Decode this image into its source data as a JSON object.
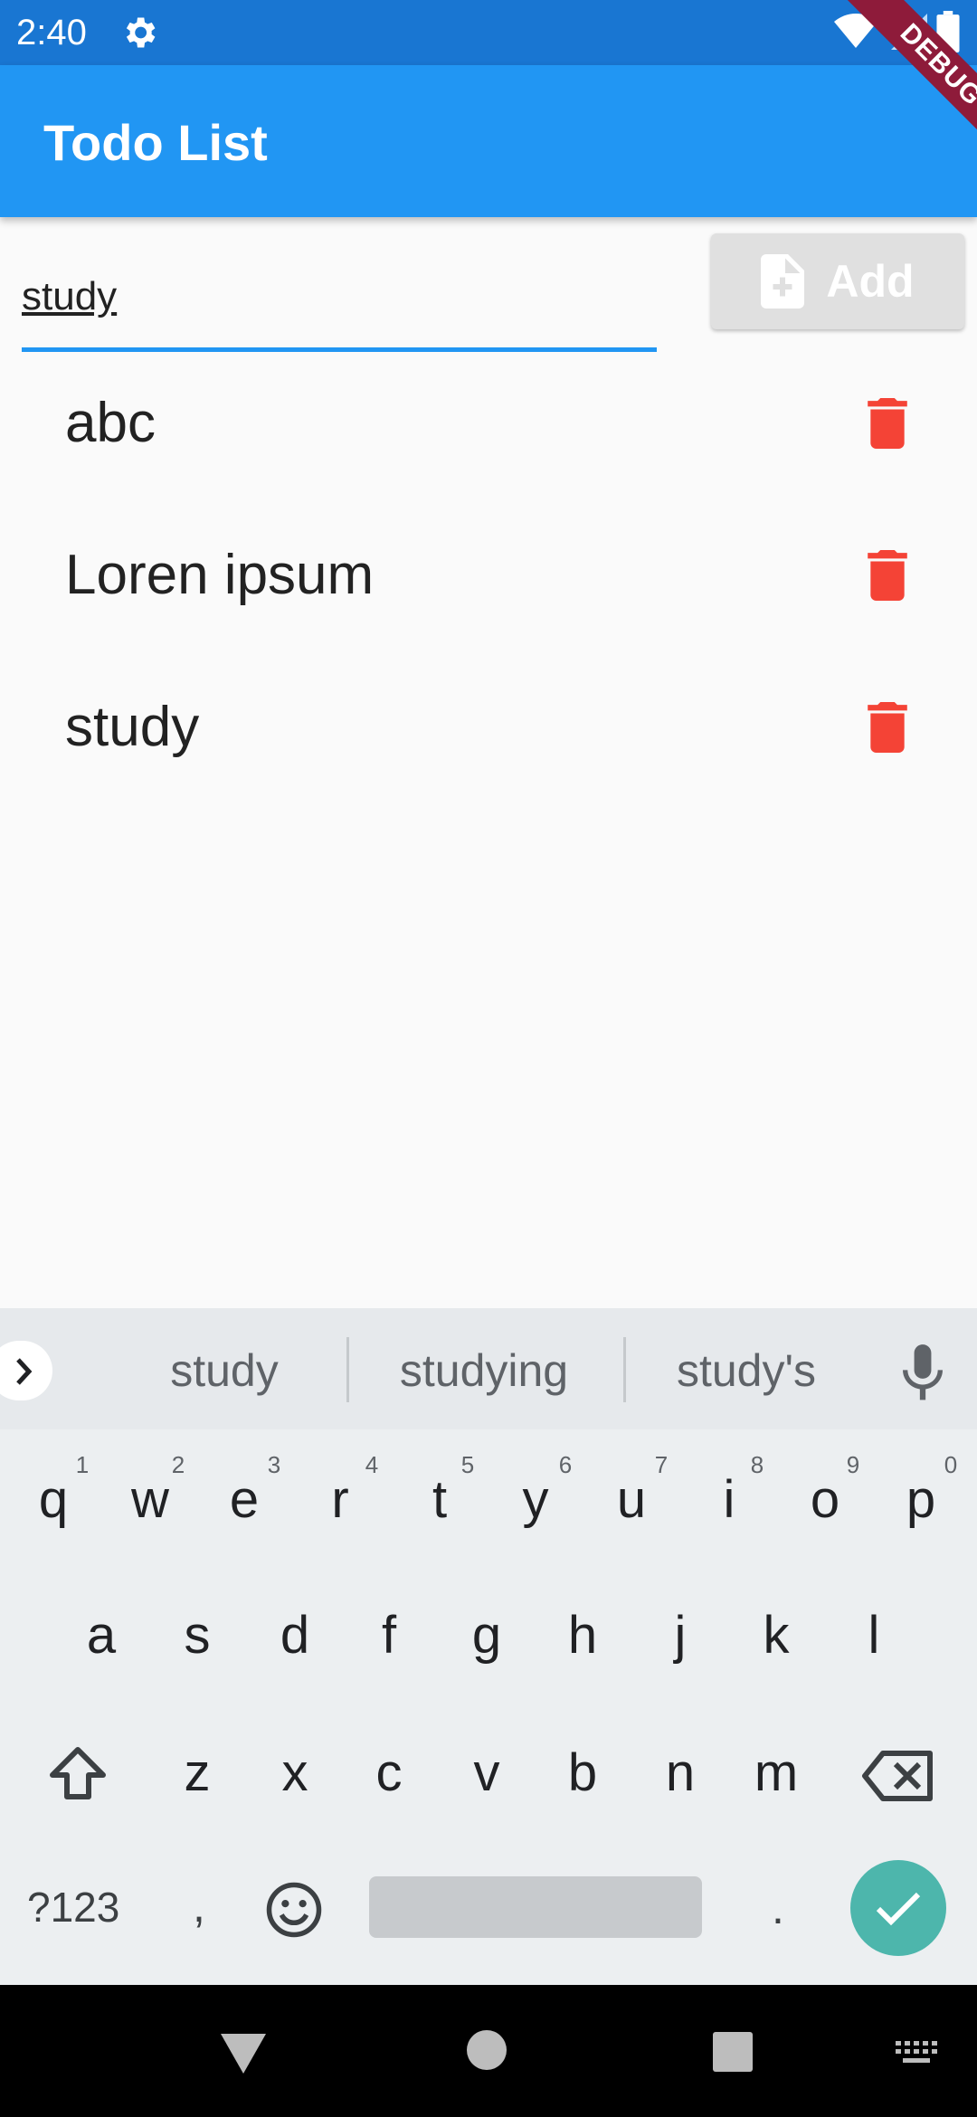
{
  "status_bar": {
    "time": "2:40",
    "icons": [
      "settings-gear-icon",
      "wifi-icon",
      "signal-icon",
      "battery-icon"
    ]
  },
  "debug_banner": {
    "label": "DEBUG"
  },
  "app_bar": {
    "title": "Todo List",
    "color": "#2196f3"
  },
  "input": {
    "value": "study",
    "underline_color": "#2196f3"
  },
  "add_button": {
    "label": "Add",
    "icon": "note-add-icon"
  },
  "todos": [
    {
      "text": "abc",
      "delete_icon": "trash-icon"
    },
    {
      "text": "Loren ipsum",
      "delete_icon": "trash-icon"
    },
    {
      "text": "study",
      "delete_icon": "trash-icon"
    }
  ],
  "delete_icon_color": "#f44336",
  "keyboard": {
    "suggestions": [
      "study",
      "studying",
      "study's"
    ],
    "row1": [
      "q",
      "w",
      "e",
      "r",
      "t",
      "y",
      "u",
      "i",
      "o",
      "p"
    ],
    "row1_hints": [
      "1",
      "2",
      "3",
      "4",
      "5",
      "6",
      "7",
      "8",
      "9",
      "0"
    ],
    "row2": [
      "a",
      "s",
      "d",
      "f",
      "g",
      "h",
      "j",
      "k",
      "l"
    ],
    "row3": [
      "z",
      "x",
      "c",
      "v",
      "b",
      "n",
      "m"
    ],
    "symbols_label": "?123",
    "comma": ",",
    "period": ".",
    "enter_color": "#4db6ac"
  },
  "nav_bar": {
    "icons": [
      "back-triangle-icon",
      "home-circle-icon",
      "recents-square-icon",
      "keyboard-switch-icon"
    ]
  }
}
